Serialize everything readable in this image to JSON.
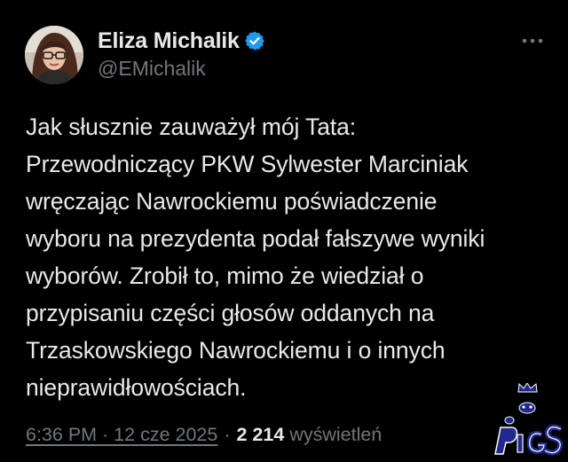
{
  "author": {
    "display_name": "Eliza Michalik",
    "handle": "@EMichalik",
    "verified": true
  },
  "icons": {
    "avatar": "profile-photo",
    "verified": "verified-badge-icon",
    "more": "more-options-icon"
  },
  "tweet": {
    "text": "Jak słusznie zauważył mój Tata:\nPrzewodniczący PKW Sylwester Marciniak\nwręczając Nawrockiemu poświadczenie\nwyboru na prezydenta podał fałszywe wyniki\nwyborów. Zrobił to, mimo że wiedział o\nprzypisaniu części głosów oddanych na\nTrzaskowskiego Nawrockiemu i o innych\nnieprawidłowościach."
  },
  "meta": {
    "timestamp": "6:36 PM · 12 cze 2025",
    "separator": "·",
    "views_count": "2 214",
    "views_label": "wyświetleń"
  },
  "watermark": {
    "text": "PiGS"
  },
  "colors": {
    "background": "#000000",
    "text_primary": "#e7e9ea",
    "text_secondary": "#71767b",
    "verified_blue": "#1d9bf0",
    "watermark_blue": "#1f2a8c"
  }
}
